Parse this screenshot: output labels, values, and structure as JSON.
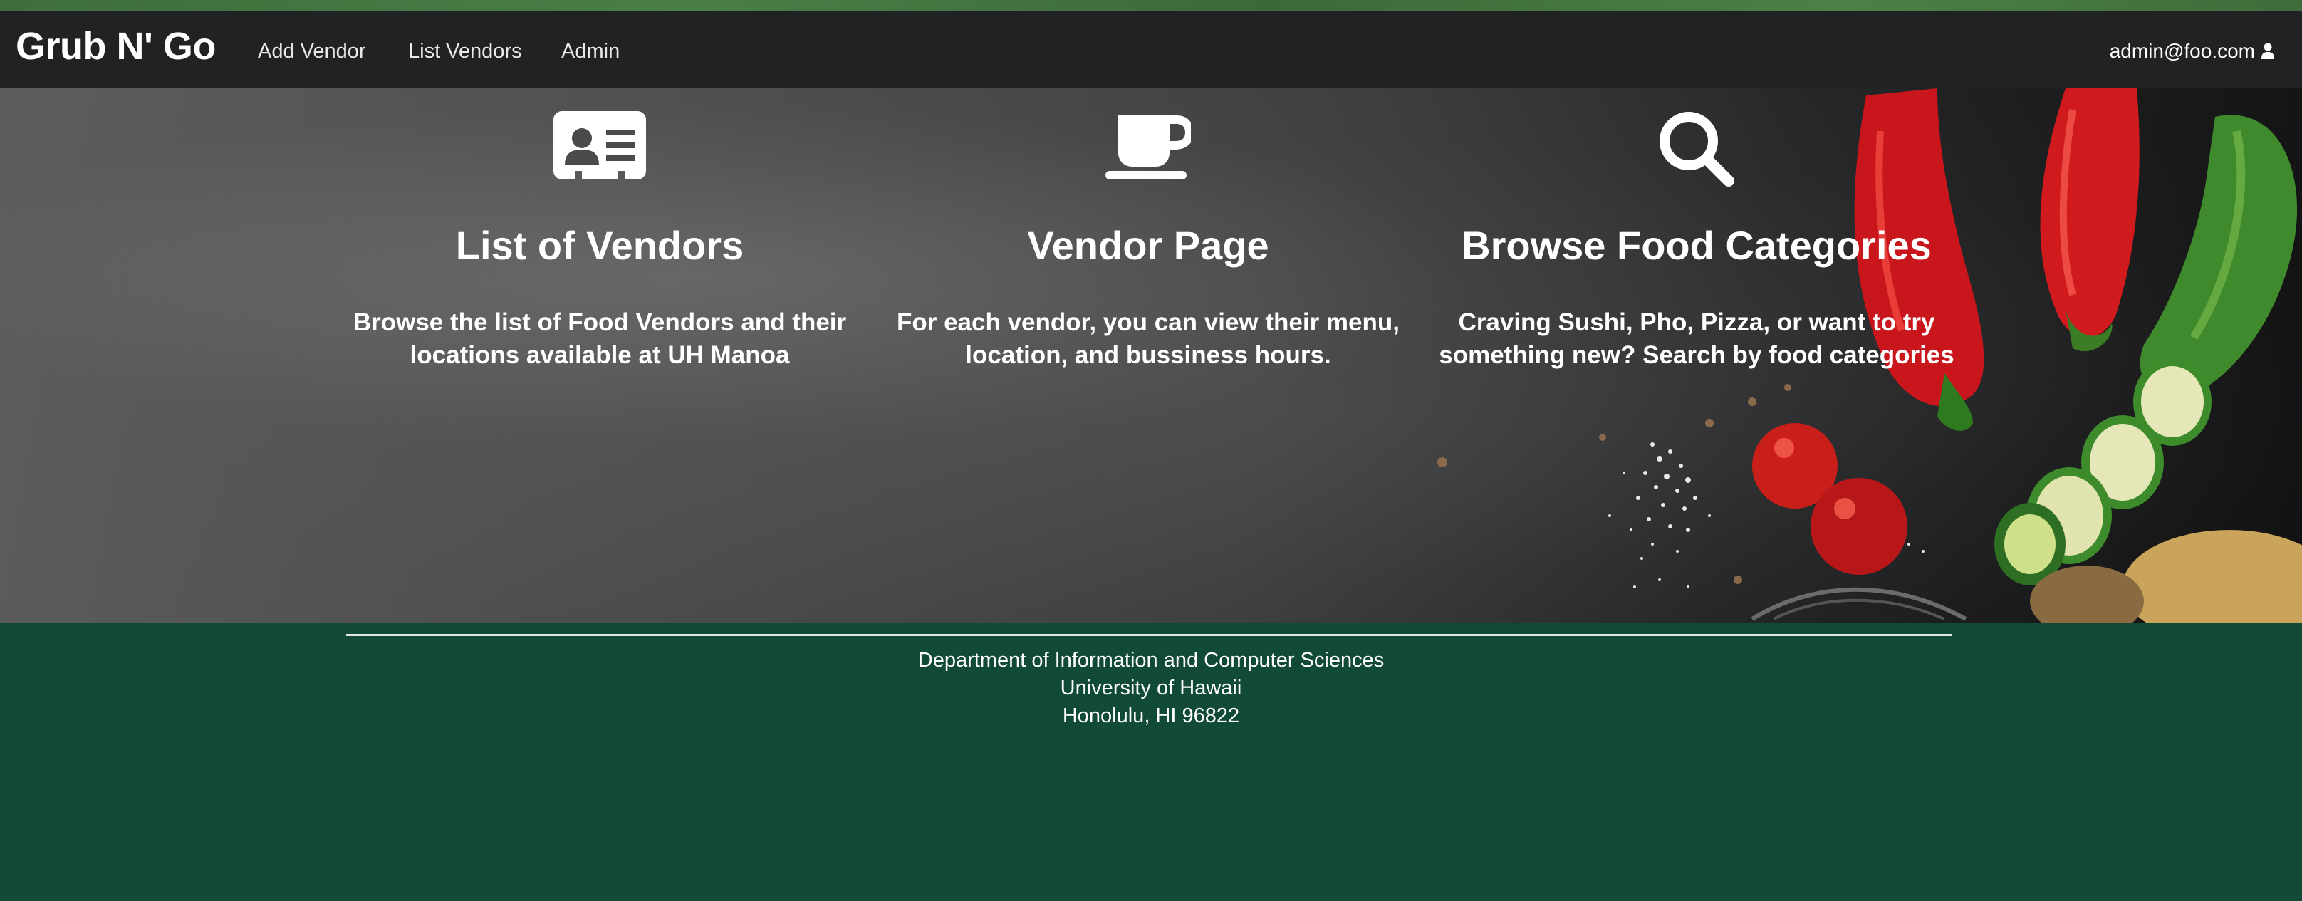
{
  "navbar": {
    "brand": "Grub N' Go",
    "links": [
      "Add Vendor",
      "List Vendors",
      "Admin"
    ],
    "user_email": "admin@foo.com"
  },
  "features": [
    {
      "icon": "id-card-icon",
      "title": "List of Vendors",
      "description": "Browse the list of Food Vendors and their locations available at UH Manoa"
    },
    {
      "icon": "coffee-cup-icon",
      "title": "Vendor Page",
      "description": "For each vendor, you can view their menu, location, and bussiness hours."
    },
    {
      "icon": "search-icon",
      "title": "Browse Food Categories",
      "description": "Craving Sushi, Pho, Pizza, or want to try something new? Search by food categories"
    }
  ],
  "footer": {
    "line1": "Department of Information and Computer Sciences",
    "line2": "University of Hawaii",
    "line3": "Honolulu, HI 96822"
  },
  "colors": {
    "navbar_bg": "#212223",
    "footer_bg": "#114A35",
    "text": "#FFFFFF"
  }
}
